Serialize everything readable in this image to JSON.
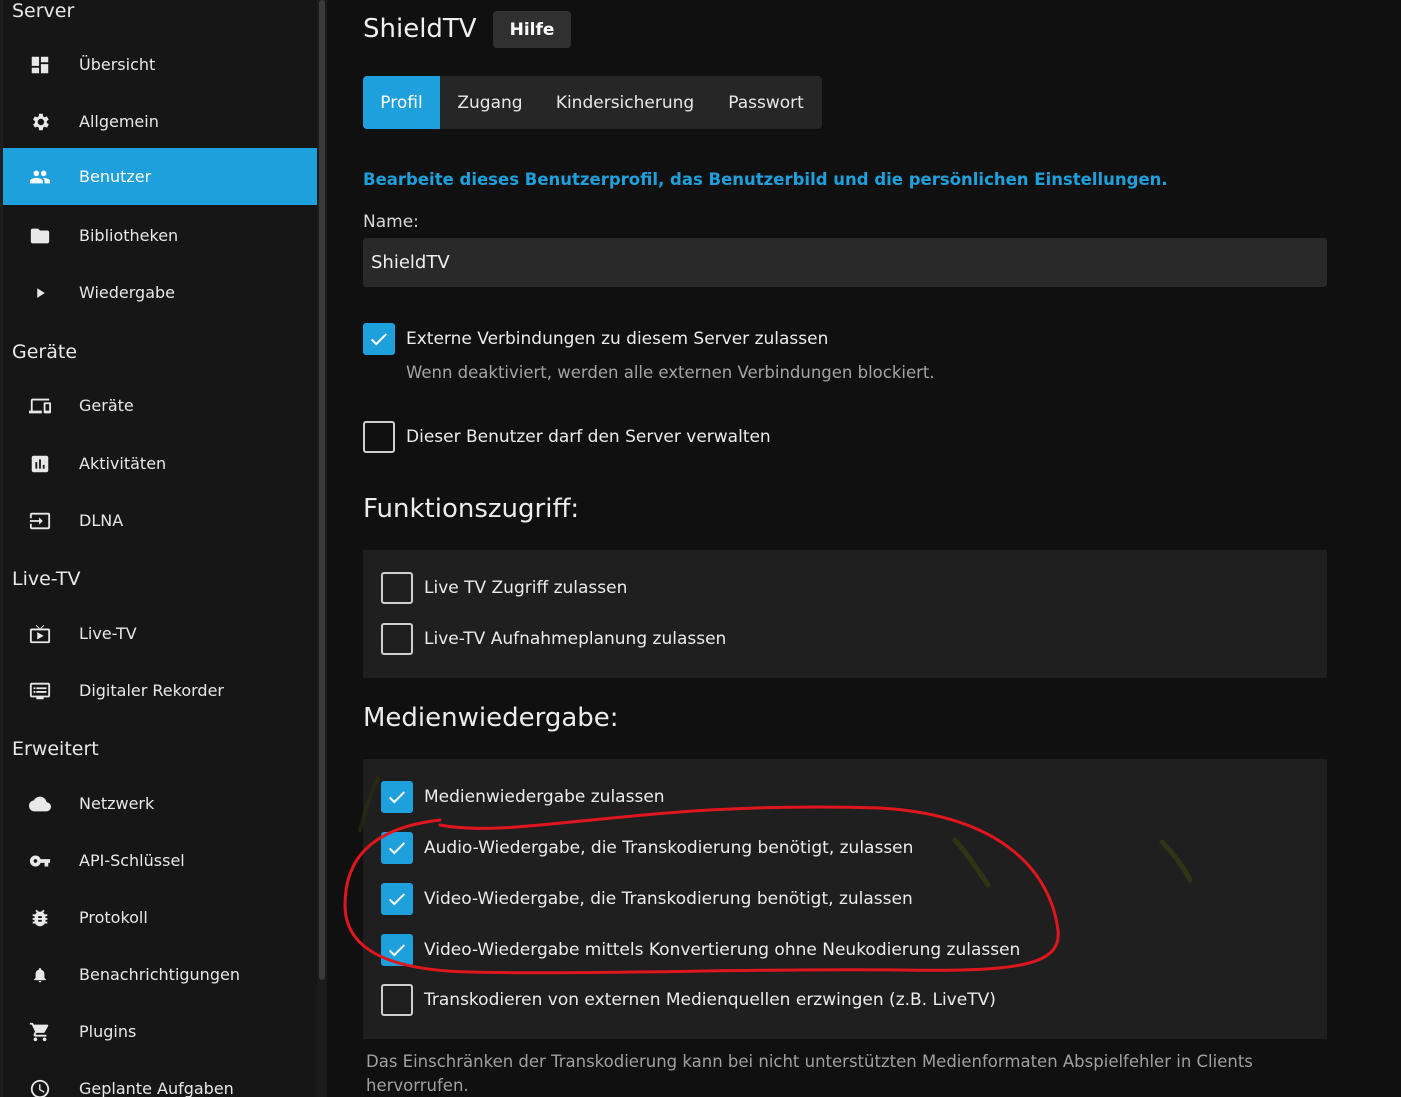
{
  "sidebar": {
    "sections": [
      {
        "title": "Server",
        "items": [
          {
            "label": "Übersicht",
            "icon": "dashboard-icon"
          },
          {
            "label": "Allgemein",
            "icon": "gear-icon"
          },
          {
            "label": "Benutzer",
            "icon": "people-icon",
            "active": true
          },
          {
            "label": "Bibliotheken",
            "icon": "folder-icon"
          },
          {
            "label": "Wiedergabe",
            "icon": "play-icon"
          }
        ]
      },
      {
        "title": "Geräte",
        "items": [
          {
            "label": "Geräte",
            "icon": "devices-icon"
          },
          {
            "label": "Aktivitäten",
            "icon": "chart-icon"
          },
          {
            "label": "DLNA",
            "icon": "input-icon"
          }
        ]
      },
      {
        "title": "Live-TV",
        "items": [
          {
            "label": "Live-TV",
            "icon": "live-tv-icon"
          },
          {
            "label": "Digitaler Rekorder",
            "icon": "dvr-icon"
          }
        ]
      },
      {
        "title": "Erweitert",
        "items": [
          {
            "label": "Netzwerk",
            "icon": "cloud-icon"
          },
          {
            "label": "API-Schlüssel",
            "icon": "key-icon"
          },
          {
            "label": "Protokoll",
            "icon": "bug-icon"
          },
          {
            "label": "Benachrichtigungen",
            "icon": "bell-icon"
          },
          {
            "label": "Plugins",
            "icon": "cart-icon"
          },
          {
            "label": "Geplante Aufgaben",
            "icon": "clock-icon"
          }
        ]
      }
    ]
  },
  "header": {
    "title": "ShieldTV",
    "help_label": "Hilfe"
  },
  "tabs": [
    {
      "label": "Profil",
      "active": true
    },
    {
      "label": "Zugang"
    },
    {
      "label": "Kindersicherung"
    },
    {
      "label": "Passwort"
    }
  ],
  "profile": {
    "intro": "Bearbeite dieses Benutzerprofil, das Benutzerbild und die persönlichen Einstellungen.",
    "name_label": "Name:",
    "name_value": "ShieldTV",
    "external": {
      "label": "Externe Verbindungen zu diesem Server zulassen",
      "checked": true,
      "hint": "Wenn deaktiviert, werden alle externen Verbindungen blockiert."
    },
    "admin": {
      "label": "Dieser Benutzer darf den Server verwalten",
      "checked": false
    }
  },
  "feature_access": {
    "heading": "Funktionszugriff:",
    "items": [
      {
        "label": "Live TV Zugriff zulassen",
        "checked": false
      },
      {
        "label": "Live-TV Aufnahmeplanung zulassen",
        "checked": false
      }
    ]
  },
  "media_playback": {
    "heading": "Medienwiedergabe:",
    "items": [
      {
        "label": "Medienwiedergabe zulassen",
        "checked": true
      },
      {
        "label": "Audio-Wiedergabe, die Transkodierung benötigt, zulassen",
        "checked": true
      },
      {
        "label": "Video-Wiedergabe, die Transkodierung benötigt, zulassen",
        "checked": true
      },
      {
        "label": "Video-Wiedergabe mittels Konvertierung ohne Neukodierung zulassen",
        "checked": true
      },
      {
        "label": "Transkodieren von externen Medienquellen erzwingen (z.B. LiveTV)",
        "checked": false
      }
    ],
    "footnote": "Das Einschränken der Transkodierung kann bei nicht unterstützten Medienformaten Abspielfehler in Clients hervorrufen."
  },
  "colors": {
    "accent": "#1ea0dc",
    "annotation": "#e0161e"
  }
}
